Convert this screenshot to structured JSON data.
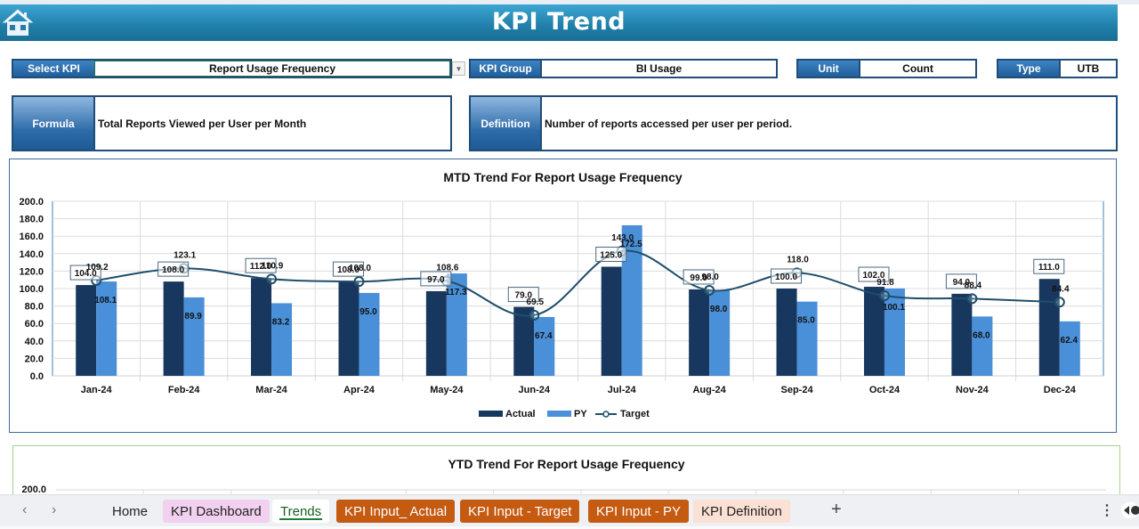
{
  "header": {
    "title": "KPI Trend",
    "home_icon": "home-icon"
  },
  "selectors": {
    "select_kpi": {
      "label": "Select KPI",
      "value": "Report Usage Frequency"
    },
    "kpi_group": {
      "label": "KPI Group",
      "value": "BI Usage"
    },
    "unit": {
      "label": "Unit",
      "value": "Count"
    },
    "type": {
      "label": "Type",
      "value": "UTB"
    }
  },
  "formula": {
    "label": "Formula",
    "value": "Total Reports Viewed per User per Month"
  },
  "definition": {
    "label": "Definition",
    "value": "Number of reports accessed per user per period."
  },
  "colors": {
    "actual": "#17375e",
    "py": "#4a90d9",
    "target": "#1f4e6b",
    "banner": "#1f7fa9"
  },
  "chart_data": [
    {
      "type": "bar",
      "title": "MTD Trend For Report Usage Frequency",
      "xlabel": "",
      "ylabel": "",
      "ylim": [
        0,
        200
      ],
      "yticks": [
        "0.0",
        "20.0",
        "40.0",
        "60.0",
        "80.0",
        "100.0",
        "120.0",
        "140.0",
        "160.0",
        "180.0",
        "200.0"
      ],
      "grid": true,
      "legend": "bottom",
      "categories": [
        "Jan-24",
        "Feb-24",
        "Mar-24",
        "Apr-24",
        "May-24",
        "Jun-24",
        "Jul-24",
        "Aug-24",
        "Sep-24",
        "Oct-24",
        "Nov-24",
        "Dec-24"
      ],
      "series": [
        {
          "name": "Actual",
          "kind": "bar",
          "values": [
            104.0,
            108.0,
            112.0,
            108.0,
            97.0,
            79.0,
            125.0,
            99.0,
            100.0,
            102.0,
            94.0,
            111.0
          ]
        },
        {
          "name": "PY",
          "kind": "bar",
          "values": [
            108.1,
            89.9,
            83.2,
            95.0,
            117.3,
            67.4,
            172.5,
            98.0,
            85.0,
            100.1,
            68.0,
            62.4
          ]
        },
        {
          "name": "Target",
          "kind": "line",
          "values": [
            109.2,
            123.1,
            110.9,
            108.0,
            108.6,
            69.5,
            143.0,
            98.0,
            118.0,
            91.8,
            88.4,
            84.4
          ]
        }
      ]
    },
    {
      "type": "bar",
      "title": "YTD Trend For Report Usage Frequency",
      "ylim": [
        0,
        200
      ],
      "yticks_visible": [
        "200.0"
      ]
    }
  ],
  "sheet_tabs": {
    "nav_prev": "‹",
    "nav_next": "›",
    "tabs": [
      {
        "label": "Home",
        "bg": "transparent",
        "fg": "#222222"
      },
      {
        "label": "KPI Dashboard",
        "bg": "#f2d0f0",
        "fg": "#222222"
      },
      {
        "label": "Trends",
        "bg": "#ffffff",
        "fg": "#1b5e20",
        "active": true
      },
      {
        "label": "KPI Input_ Actual",
        "bg": "#c55a11",
        "fg": "#ffffff"
      },
      {
        "label": "KPI Input - Target",
        "bg": "#c55a11",
        "fg": "#ffffff"
      },
      {
        "label": "KPI Input - PY",
        "bg": "#c55a11",
        "fg": "#ffffff"
      },
      {
        "label": "KPI Definition",
        "bg": "#fbe0d4",
        "fg": "#222222"
      }
    ],
    "add_label": "+",
    "more_label": "⋮"
  }
}
